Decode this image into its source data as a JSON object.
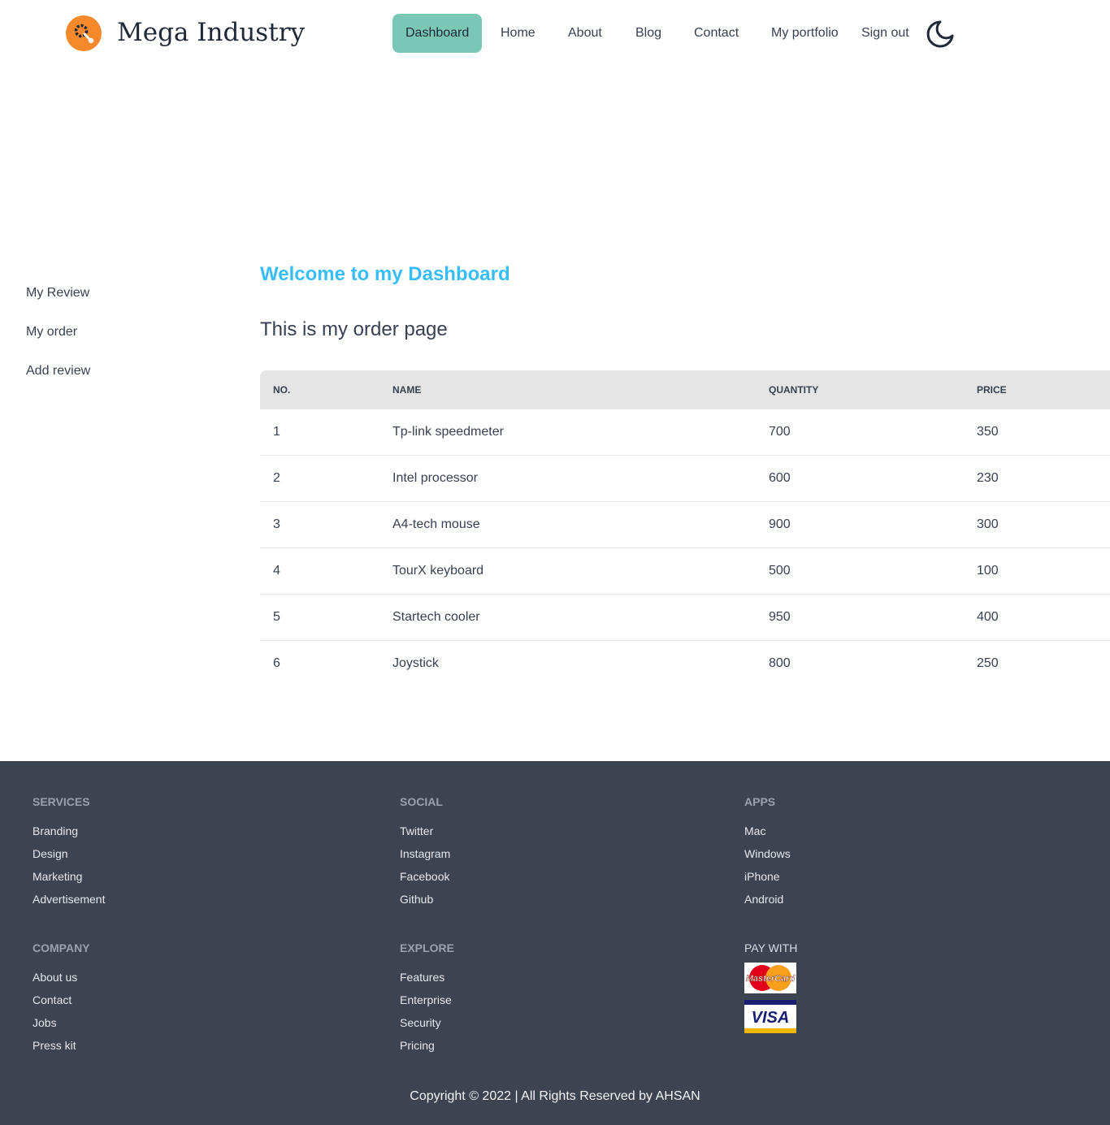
{
  "header": {
    "brand": "Mega Industry",
    "nav": [
      "Dashboard",
      "Home",
      "About",
      "Blog",
      "Contact",
      "My portfolio",
      "Sign out"
    ],
    "active_nav": "Dashboard",
    "logo_icon": "gear-wrench-icon",
    "theme_icon": "moon-icon"
  },
  "sidebar": {
    "items": [
      "My Review",
      "My order",
      "Add review"
    ]
  },
  "main": {
    "welcome": "Welcome to my Dashboard",
    "subtitle": "This is my order page",
    "table": {
      "headers": [
        "NO.",
        "NAME",
        "QUANTITY",
        "PRICE"
      ],
      "rows": [
        [
          "1",
          "Tp-link speedmeter",
          "700",
          "350"
        ],
        [
          "2",
          "Intel processor",
          "600",
          "230"
        ],
        [
          "3",
          "A4-tech mouse",
          "900",
          "300"
        ],
        [
          "4",
          "TourX keyboard",
          "500",
          "100"
        ],
        [
          "5",
          "Startech cooler",
          "950",
          "400"
        ],
        [
          "6",
          "Joystick",
          "800",
          "250"
        ]
      ]
    }
  },
  "footer": {
    "services": {
      "title": "SERVICES",
      "links": [
        "Branding",
        "Design",
        "Marketing",
        "Advertisement"
      ]
    },
    "social": {
      "title": "SOCIAL",
      "links": [
        "Twitter",
        "Instagram",
        "Facebook",
        "Github"
      ]
    },
    "apps": {
      "title": "APPS",
      "links": [
        "Mac",
        "Windows",
        "iPhone",
        "Android"
      ]
    },
    "company": {
      "title": "COMPANY",
      "links": [
        "About us",
        "Contact",
        "Jobs",
        "Press kit"
      ]
    },
    "explore": {
      "title": "EXPLORE",
      "links": [
        "Features",
        "Enterprise",
        "Security",
        "Pricing"
      ]
    },
    "pay": {
      "title": "PAY WITH",
      "cards": [
        "MasterCard",
        "VISA"
      ]
    },
    "copyright": "Copyright © 2022 | All Rights Reserved by AHSAN"
  },
  "colors": {
    "accent_active": "#7ac7b5",
    "welcome": "#38bdf8",
    "logo": "#f7892d",
    "footer_bg": "#3d4451",
    "table_header_bg": "#e5e5e5"
  }
}
